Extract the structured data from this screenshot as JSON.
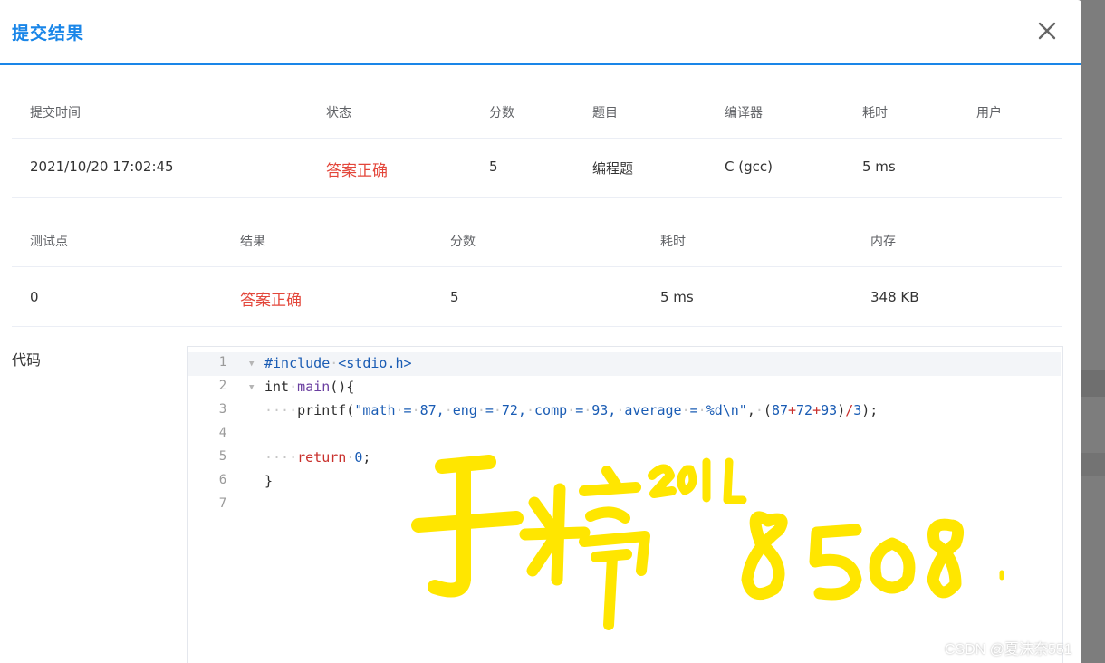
{
  "dialog": {
    "title": "提交结果",
    "close_icon": "close-icon",
    "accent_color": "#1a86e8",
    "success_color": "#e3463a"
  },
  "submission_table": {
    "headers": [
      "提交时间",
      "状态",
      "分数",
      "题目",
      "编译器",
      "耗时",
      "用户"
    ],
    "row": {
      "time": "2021/10/20 17:02:45",
      "status": "答案正确",
      "score": "5",
      "problem": "编程题",
      "compiler": "C (gcc)",
      "duration": "5 ms",
      "user": ""
    }
  },
  "testcase_table": {
    "headers": [
      "测试点",
      "结果",
      "分数",
      "耗时",
      "内存"
    ],
    "row": {
      "case": "0",
      "result": "答案正确",
      "score": "5",
      "duration": "5 ms",
      "memory": "348 KB"
    }
  },
  "code": {
    "label": "代码",
    "line_numbers": [
      "1",
      "2",
      "3",
      "4",
      "5",
      "6",
      "7"
    ],
    "lines": [
      "#include <stdio.h>",
      "int main(){",
      "    printf(\"math = 87, eng = 72, comp = 93, average = %d\\n\", (87+72+93)/3);",
      "",
      "    return 0;",
      "}",
      ""
    ]
  },
  "annotation": {
    "handwritten_text": "于婷 2011 8508",
    "color": "#ffe600"
  },
  "watermark": "CSDN @夏沫奈551"
}
